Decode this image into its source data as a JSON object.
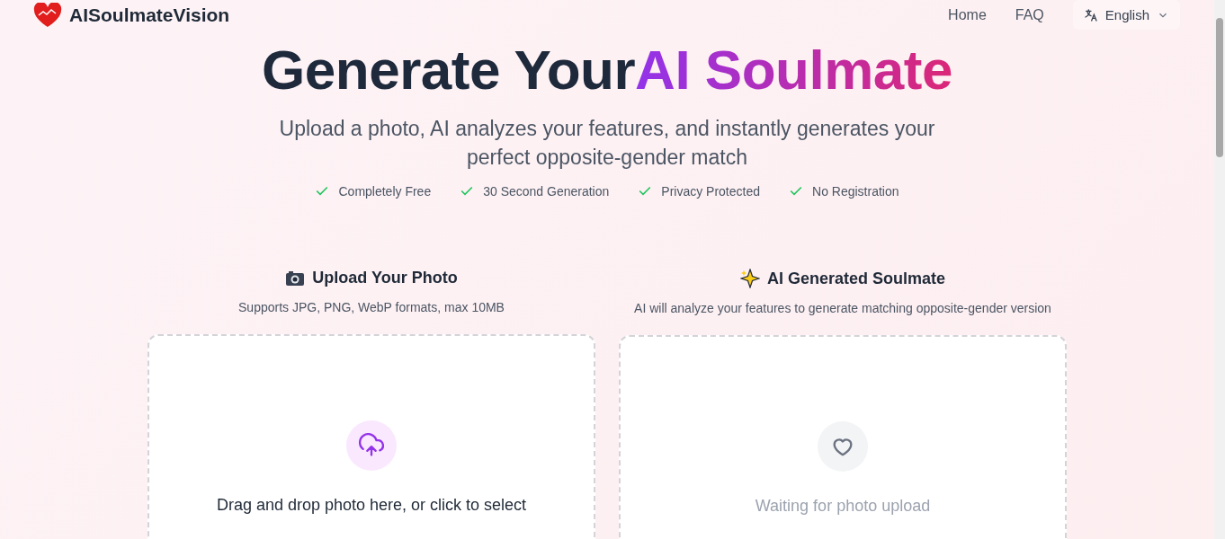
{
  "header": {
    "brand": "AISoulmateVision",
    "nav": [
      {
        "label": "Home"
      },
      {
        "label": "FAQ"
      }
    ],
    "language": "English"
  },
  "hero": {
    "title_prefix": "Generate Your",
    "title_highlight": "AI Soulmate",
    "subtitle": "Upload a photo, AI analyzes your features, and instantly generates your perfect opposite-gender match",
    "features": [
      "Completely Free",
      "30 Second Generation",
      "Privacy Protected",
      "No Registration"
    ]
  },
  "panels": [
    {
      "kind": "upload",
      "title": "Upload Your Photo",
      "caption": "Supports JPG, PNG, WebP formats, max 10MB",
      "message": "Drag and drop photo here, or click to select"
    },
    {
      "kind": "result",
      "title": "AI Generated Soulmate",
      "caption": "AI will analyze your features to generate matching opposite-gender version",
      "message": "Waiting for photo upload"
    }
  ]
}
